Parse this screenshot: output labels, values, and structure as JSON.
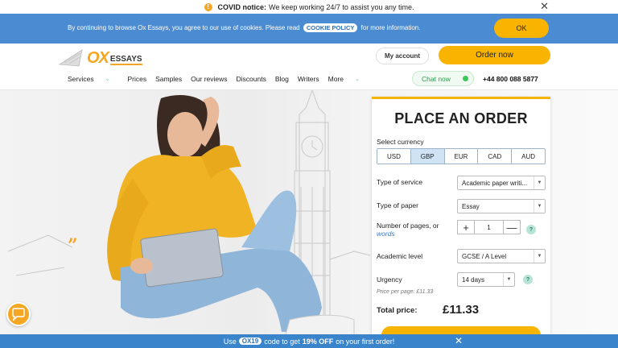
{
  "covid": {
    "title": "COVID notice:",
    "message": "We keep working 24/7 to assist you any time.",
    "close": "✕"
  },
  "cookie": {
    "text_before": "By continuing to browse Ox Essays, you agree to our use of cookies. Please read",
    "policy_link": "COOKIE POLICY",
    "text_after": "for more information.",
    "ok": "OK"
  },
  "header": {
    "logo_ox": "OX",
    "logo_essays": "ESSAYS",
    "my_account": "My account",
    "order_now": "Order now",
    "chat_now": "Chat now",
    "phone": "+44 800 088 5877",
    "nav": [
      "Services",
      "Prices",
      "Samples",
      "Our reviews",
      "Discounts",
      "Blog",
      "Writers",
      "More"
    ]
  },
  "order_form": {
    "title": "PLACE AN ORDER",
    "currency_label": "Select currency",
    "currencies": [
      "USD",
      "GBP",
      "EUR",
      "CAD",
      "AUD"
    ],
    "selected_currency": "GBP",
    "service_label": "Type of service",
    "service_value": "Academic paper writi...",
    "paper_label": "Type of paper",
    "paper_value": "Essay",
    "pages_label": "Number of pages, or",
    "pages_link": "words",
    "pages_value": "1",
    "level_label": "Academic level",
    "level_value": "GCSE / A Level",
    "urgency_label": "Urgency",
    "urgency_value": "14 days",
    "price_per_page": "Price per page:  £11.33",
    "total_label": "Total price:",
    "total_value": "£11.33",
    "help": "?"
  },
  "promo": {
    "use": "Use",
    "code": "OX19",
    "middle": "code to get",
    "discount": "19% OFF",
    "end": "on your first order!",
    "close": "✕"
  },
  "colors": {
    "accent": "#f8b400",
    "blue_bar": "#4a8bd1",
    "promo_bar": "#3a84cc"
  }
}
